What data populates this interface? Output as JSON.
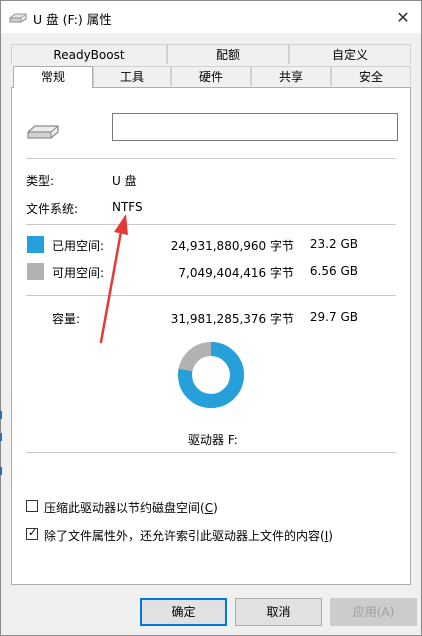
{
  "window": {
    "title": "U 盘 (F:) 属性",
    "close_glyph": "✕"
  },
  "tabs_back": [
    "ReadyBoost",
    "配额",
    "自定义"
  ],
  "tabs_front": [
    "常规",
    "工具",
    "硬件",
    "共享",
    "安全"
  ],
  "general": {
    "drive_name_value": "",
    "type_label": "类型:",
    "type_value": "U 盘",
    "fs_label": "文件系统:",
    "fs_value": "NTFS",
    "used": {
      "label": "已用空间:",
      "bytes": "24,931,880,960 字节",
      "size": "23.2 GB",
      "color": "#26a0da"
    },
    "free": {
      "label": "可用空间:",
      "bytes": "7,049,404,416 字节",
      "size": "6.56 GB",
      "color": "#b2b2b2"
    },
    "capacity": {
      "label": "容量:",
      "bytes": "31,981,285,376 字节",
      "size": "29.7 GB"
    },
    "used_fraction": 0.7796,
    "drive_caption": "驱动器 F:",
    "compress": {
      "checked": false,
      "text": "压缩此驱动器以节约磁盘空间",
      "key": "C"
    },
    "index": {
      "checked": true,
      "text": "除了文件属性外，还允许索引此驱动器上文件的内容",
      "key": "I"
    }
  },
  "buttons": {
    "ok": "确定",
    "cancel": "取消",
    "apply": "应用(A)"
  },
  "annotation_color": "#e53935"
}
